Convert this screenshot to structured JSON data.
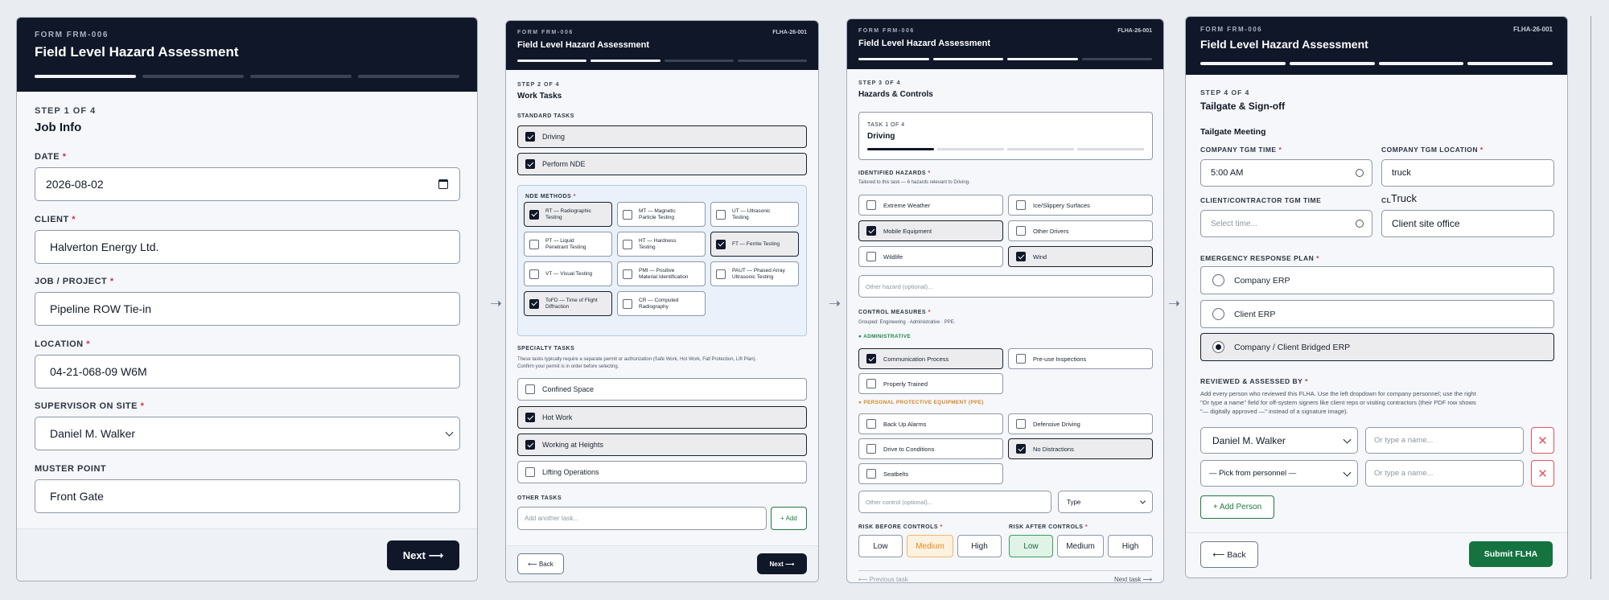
{
  "p1": {
    "form_no": "FORM FRM-006",
    "title": "Field Level Hazard Assessment",
    "step": "STEP 1 OF 4",
    "step_name": "Job Info",
    "fields": [
      {
        "label": "DATE",
        "value": "2026-08-02"
      },
      {
        "label": "CLIENT",
        "value": "Halverton Energy Ltd."
      },
      {
        "label": "JOB / PROJECT",
        "value": "Pipeline ROW Tie-in"
      },
      {
        "label": "LOCATION",
        "value": "04-21-068-09 W6M"
      },
      {
        "label": "SUPERVISOR ON SITE",
        "value": "Daniel M. Walker"
      },
      {
        "label": "MUSTER POINT",
        "value": "Front Gate"
      }
    ],
    "next": "Next ⟶"
  },
  "p2": {
    "form_no": "FORM FRM-006",
    "code": "FLHA-26-001",
    "title": "Field Level Hazard Assessment",
    "step": "STEP 2 OF 4",
    "step_name": "Work Tasks",
    "standard_label": "STANDARD TASKS",
    "standard": [
      "Driving",
      "Perform NDE"
    ],
    "nde_label": "NDE METHODS",
    "nde": [
      [
        "RT — Radiographic",
        "Testing"
      ],
      [
        "MT — Magnetic",
        "Particle Testing"
      ],
      [
        "UT — Ultrasonic",
        "Testing"
      ],
      [
        "PT — Liquid",
        "Penetrant Testing"
      ],
      [
        "HT — Hardness",
        "Testing"
      ],
      [
        "FT — Ferrite Testing",
        ""
      ],
      [
        "VT — Visual Testing",
        ""
      ],
      [
        "PMI — Positive",
        "Material Identification"
      ],
      [
        "PAUT — Phased Array",
        "Ultrasonic Testing"
      ],
      [
        "ToFD — Time of Flight",
        "Diffraction"
      ],
      [
        "CR — Computed",
        "Radiography"
      ]
    ],
    "specialty_label": "SPECIALTY TASKS",
    "specialty_note_1": "These tasks typically require a separate permit or authorization (Safe Work, Hot Work, Fall Protection, Lift Plan).",
    "specialty_note_2": "Confirm your permit is in order before selecting.",
    "specialty": [
      "Confined Space",
      "Hot Work",
      "Working at Heights",
      "Lifting Operations"
    ],
    "other_label": "OTHER TASKS",
    "other_placeholder": "Add another task...",
    "add": "+ Add",
    "back": "⟵ Back",
    "next": "Next ⟶"
  },
  "p3": {
    "form_no": "FORM FRM-006",
    "code": "FLHA-26-001",
    "title": "Field Level Hazard Assessment",
    "step": "STEP 3 OF 4",
    "step_name": "Hazards & Controls",
    "task_count": "TASK 1 OF 4",
    "task_name": "Driving",
    "hazards_label": "IDENTIFIED HAZARDS",
    "hazards_note": "Tailored to this task — 6 hazards relevant to Driving.",
    "hazards": [
      "Extreme Weather",
      "Ice/Slippery Surfaces",
      "Mobile Equipment",
      "Other Drivers",
      "Wildlife",
      "Wind"
    ],
    "other_hazard_ph": "Other hazard (optional)...",
    "controls_label": "CONTROL MEASURES",
    "controls_note": "Grouped: Engineering · Administrative · PPE.",
    "admin_label": "ADMINISTRATIVE",
    "admin": [
      "Communication Process",
      "Pre-use Inspections",
      "Properly Trained"
    ],
    "ppe_label": "PERSONAL PROTECTIVE EQUIPMENT (PPE)",
    "ppe": [
      "Back Up Alarms",
      "Defensive Driving",
      "Drive to Conditions",
      "No Distractions",
      "Seatbelts"
    ],
    "other_control_ph": "Other control (optional)...",
    "type": "Type",
    "risk_before_label": "RISK BEFORE CONTROLS",
    "risk_after_label": "RISK AFTER CONTROLS",
    "risk_levels": [
      "Low",
      "Medium",
      "High"
    ],
    "prev_task": "⟵ Previous task",
    "next_task": "Next task ⟶"
  },
  "p4": {
    "form_no": "FORM FRM-006",
    "code": "FLHA-26-001",
    "title": "Field Level Hazard Assessment",
    "step": "STEP 4 OF 4",
    "step_name": "Tailgate & Sign-off",
    "tgm_heading": "Tailgate Meeting",
    "tgm_time_label": "COMPANY TGM TIME",
    "tgm_time": "5:00 AM",
    "tgm_loc_label": "COMPANY TGM LOCATION",
    "tgm_loc": "truck",
    "cc_time_label": "CLIENT/CONTRACTOR TGM TIME",
    "cc_time_ph": "Select time...",
    "cc_loc_label_stub": "CL",
    "cc_loc_autocomplete": "Truck",
    "cc_loc": "Client site office",
    "erp_label": "EMERGENCY RESPONSE PLAN",
    "erp": [
      "Company ERP",
      "Client ERP",
      "Company / Client Bridged ERP"
    ],
    "reviewed_label": "REVIEWED & ASSESSED BY",
    "reviewed_note_1": "Add every person who reviewed this FLHA. Use the left dropdown for company personnel; use the right",
    "reviewed_note_2": "\"Or type a name\" field for off-system signers like client reps or visiting contractors (their PDF row shows",
    "reviewed_note_3": "\"— digitally approved —\" instead of a signature image).",
    "person1": "Daniel M. Walker",
    "person2": "— Pick from personnel —",
    "name_ph": "Or type a name...",
    "add_person": "+ Add Person",
    "back": "⟵ Back",
    "submit": "Submit FLHA"
  }
}
